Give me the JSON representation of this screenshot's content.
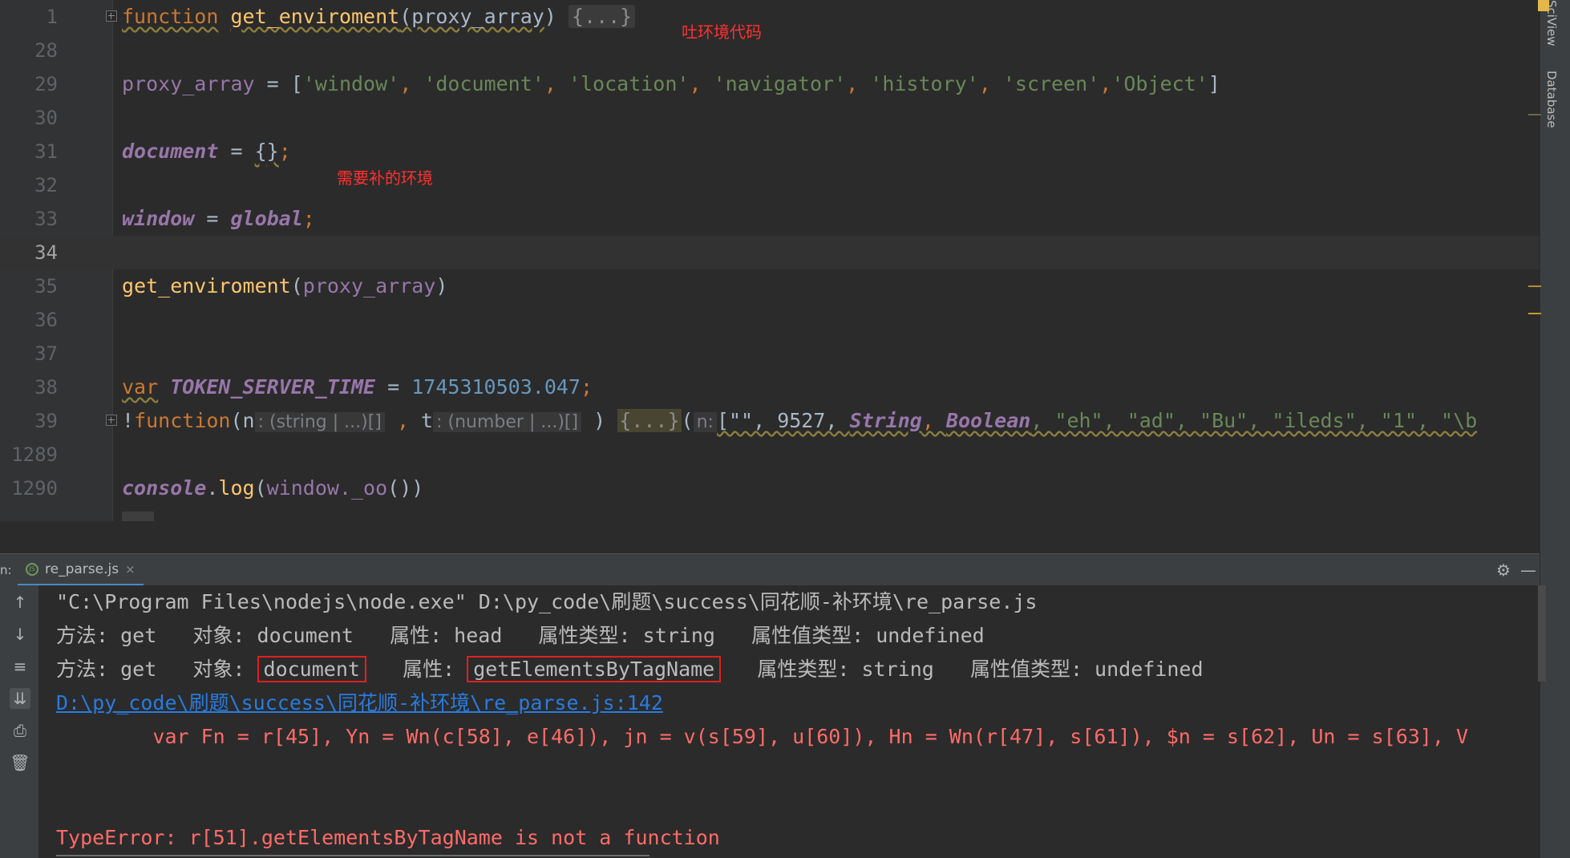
{
  "editor": {
    "lines": [
      {
        "num": "1"
      },
      {
        "num": "28"
      },
      {
        "num": "29"
      },
      {
        "num": "30"
      },
      {
        "num": "31"
      },
      {
        "num": "32"
      },
      {
        "num": "33"
      },
      {
        "num": "34"
      },
      {
        "num": "35"
      },
      {
        "num": "36"
      },
      {
        "num": "37"
      },
      {
        "num": "38"
      },
      {
        "num": "39"
      },
      {
        "num": "1289"
      },
      {
        "num": "1290"
      }
    ],
    "l1": {
      "kw": "function",
      "name": "get_enviroment",
      "open": "(",
      "param": "proxy_array",
      "close": ")",
      "folded": "{...}"
    },
    "l29": {
      "var": "proxy_array",
      "eq": " = [",
      "items": [
        "'window'",
        "'document'",
        "'location'",
        "'navigator'",
        "'history'",
        "'screen'",
        "'Object'"
      ],
      "sep": ", ",
      "end": "]"
    },
    "l31": {
      "var": "document",
      "eq": " = ",
      "val": "{}",
      "semi": ";"
    },
    "l33": {
      "var": "window",
      "eq": " = ",
      "val": "global",
      "semi": ";"
    },
    "l35": {
      "name": "get_enviroment",
      "open": "(",
      "param": "proxy_array",
      "close": ")"
    },
    "l38": {
      "kw": "var",
      "name": "TOKEN_SERVER_TIME",
      "eq": " = ",
      "val": "1745310503.047",
      "semi": ";"
    },
    "l39": {
      "bang": "!",
      "kw": "function",
      "open": "(",
      "p1": "n",
      "h1": ": (string | ...)[]",
      "comma": " , ",
      "p2": "t",
      "h2": ": (number | ...)[]",
      "close": " ) ",
      "folded": "{...}",
      "argopen": "(",
      "h3": "n:",
      "arr": "[\"\", 9527, ",
      "s1": "String",
      "c1": ", ",
      "s2": "Boolean",
      "rest": ", \"eh\", \"ad\", \"Bu\", \"ileds\", \"1\", \"\\b"
    },
    "l1290": {
      "obj": "console",
      "dot": ".",
      "method": "log",
      "open": "(",
      "arg": "window",
      "dot2": "._oo",
      "close": "())"
    }
  },
  "annotations": {
    "env_code": "吐环境代码",
    "need_env": "需要补的环境"
  },
  "side_tabs": {
    "top": "SciView",
    "database": "Database"
  },
  "run_panel": {
    "prefix": "n:",
    "tab_label": "re_parse.js",
    "tab_close": "×",
    "settings": "⚙",
    "minimize": "—",
    "lines": {
      "cmd": "\"C:\\Program Files\\nodejs\\node.exe\" D:\\py_code\\刷题\\success\\同花顺-补环境\\re_parse.js",
      "l2": "方法: get   对象: document   属性: head   属性类型: string   属性值类型: undefined",
      "l3_a": "方法: get   对象: ",
      "l3_obj": "document",
      "l3_b": "   属性: ",
      "l3_prop": "getElementsByTagName",
      "l3_c": "   属性类型: string   属性值类型: undefined",
      "link": "D:\\py_code\\刷题\\success\\同花顺-补环境\\re_parse.js:142",
      "code": "        var Fn = r[45], Yn = Wn(c[58], e[46]), jn = v(s[59], u[60]), Hn = Wn(r[47], s[61]), $n = s[62], Un = s[63], V",
      "error": "TypeError: r[51].getElementsByTagName is not a function"
    }
  },
  "colors": {
    "keyword": "#cc7832",
    "function": "#ffc66d",
    "string": "#6a8759",
    "number": "#6897bb",
    "global": "#9876aa",
    "error": "#ff6b68",
    "link": "#287bde",
    "annotation": "#ff3030"
  }
}
